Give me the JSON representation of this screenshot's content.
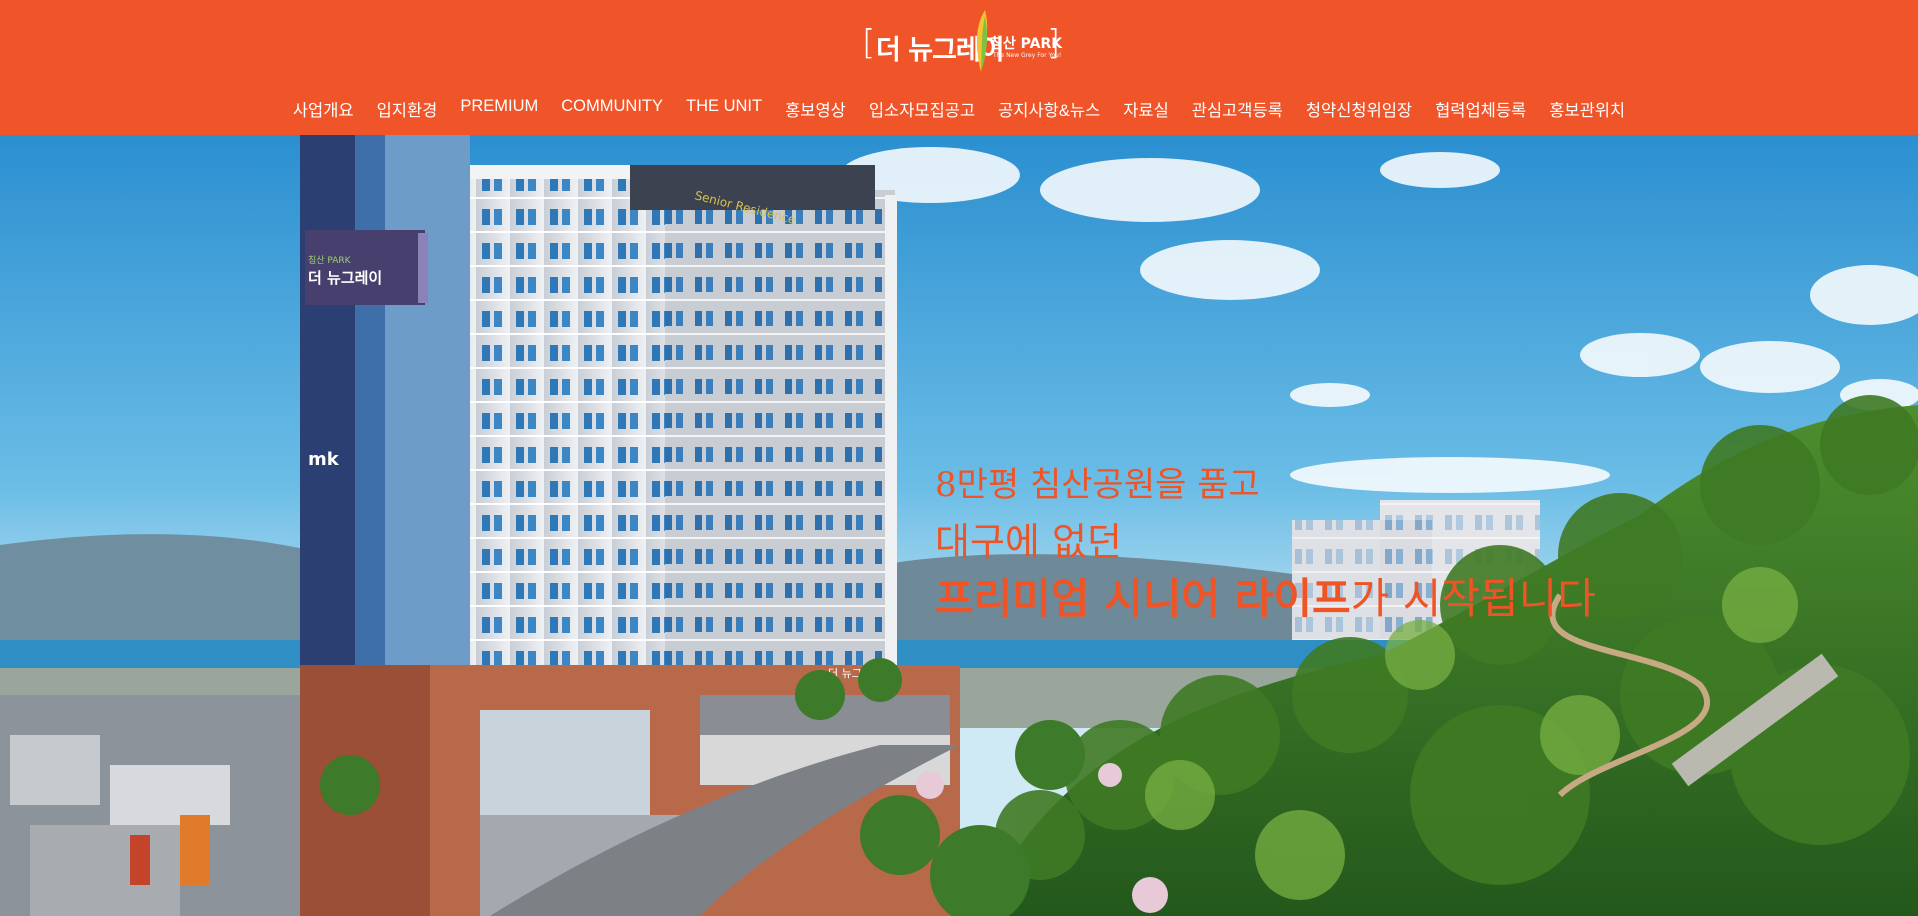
{
  "logo": {
    "main": "더 뉴그레이",
    "sub_title": "침산 PARK",
    "tagline": "The New Grey For You!",
    "building_sign": "Senior Residence",
    "tower_sign_small": "침산 PARK",
    "tower_sign": "더 뉴그레이",
    "podium_sign": "더 뉴그레이",
    "builder_mark": "mk"
  },
  "nav": {
    "items": [
      "사업개요",
      "입지환경",
      "PREMIUM",
      "COMMUNITY",
      "THE UNIT",
      "홍보영상",
      "입소자모집공고",
      "공지사항&뉴스",
      "자료실",
      "관심고객등록",
      "청약신청위임장",
      "협력업체등록",
      "홍보관위치"
    ]
  },
  "hero": {
    "line1": "8만평 침산공원을 품고",
    "line2": "대구에 없던",
    "line3_bold": "프리미엄 시니어 라이프",
    "line3_rest": "가 시작됩니다"
  },
  "colors": {
    "brand_orange": "#f0552a",
    "headline_orange": "#ef5427",
    "sky_blue": "#4aa6dc"
  }
}
